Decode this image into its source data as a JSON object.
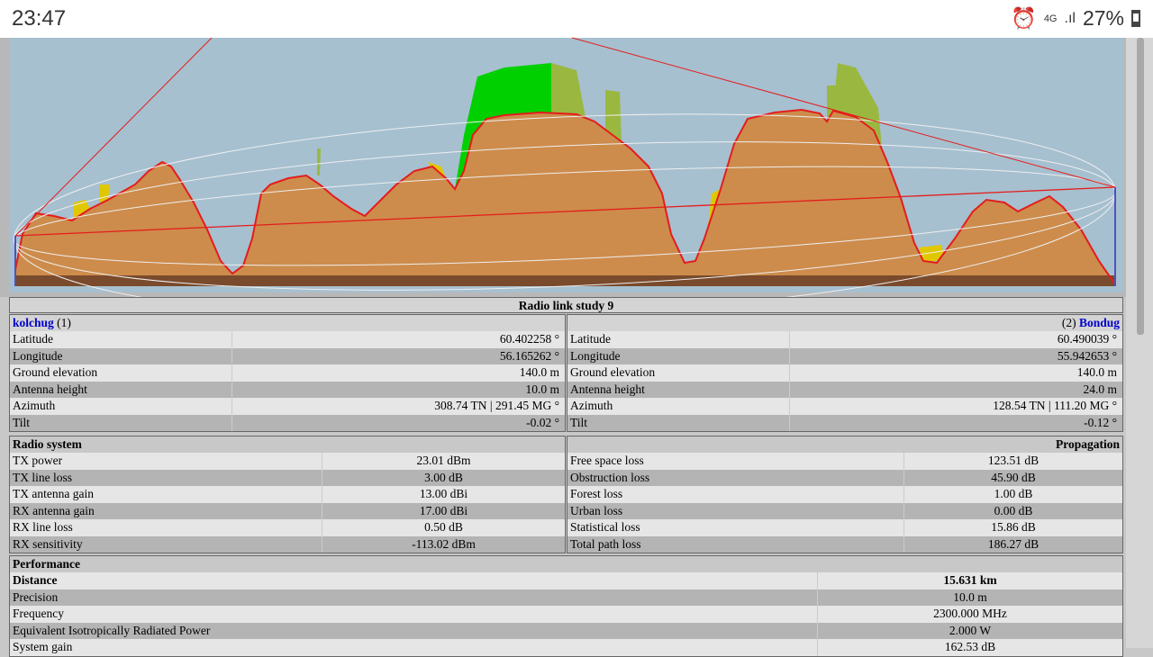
{
  "status_bar": {
    "time": "23:47",
    "network": "4G",
    "battery": "27%",
    "icons": [
      "alarm-icon",
      "signal-icon",
      "battery-icon"
    ]
  },
  "title": "Radio link study 9",
  "site1": {
    "name": "kolchug",
    "index": "(1)",
    "rows": [
      {
        "label": "Latitude",
        "value": "60.402258 °"
      },
      {
        "label": "Longitude",
        "value": "56.165262 °"
      },
      {
        "label": "Ground elevation",
        "value": "140.0 m"
      },
      {
        "label": "Antenna height",
        "value": "10.0 m"
      },
      {
        "label": "Azimuth",
        "value": "308.74 TN | 291.45 MG °"
      },
      {
        "label": "Tilt",
        "value": "-0.02 °"
      }
    ]
  },
  "site2": {
    "name": "Bondug",
    "index": "(2)",
    "rows": [
      {
        "label": "Latitude",
        "value": "60.490039 °"
      },
      {
        "label": "Longitude",
        "value": "55.942653 °"
      },
      {
        "label": "Ground elevation",
        "value": "140.0 m"
      },
      {
        "label": "Antenna height",
        "value": "24.0 m"
      },
      {
        "label": "Azimuth",
        "value": "128.54 TN | 111.20 MG °"
      },
      {
        "label": "Tilt",
        "value": "-0.12 °"
      }
    ]
  },
  "radio": {
    "heading": "Radio system",
    "rows": [
      {
        "label": "TX power",
        "value": "23.01 dBm"
      },
      {
        "label": "TX line loss",
        "value": "3.00 dB"
      },
      {
        "label": "TX antenna gain",
        "value": "13.00 dBi"
      },
      {
        "label": "RX antenna gain",
        "value": "17.00 dBi"
      },
      {
        "label": "RX line loss",
        "value": "0.50 dB"
      },
      {
        "label": "RX sensitivity",
        "value": "-113.02 dBm"
      }
    ]
  },
  "propagation": {
    "heading": "Propagation",
    "rows": [
      {
        "label": "Free space loss",
        "value": "123.51 dB"
      },
      {
        "label": "Obstruction loss",
        "value": "45.90 dB"
      },
      {
        "label": "Forest loss",
        "value": "1.00 dB"
      },
      {
        "label": "Urban loss",
        "value": "0.00 dB"
      },
      {
        "label": "Statistical loss",
        "value": "15.86 dB"
      },
      {
        "label": "Total path loss",
        "value": "186.27 dB"
      }
    ]
  },
  "performance": {
    "heading": "Performance",
    "rows": [
      {
        "label": "Distance",
        "value": "15.631 km"
      },
      {
        "label": "Precision",
        "value": "10.0 m"
      },
      {
        "label": "Frequency",
        "value": "2300.000 MHz"
      },
      {
        "label": "Equivalent Isotropically Radiated Power",
        "value": "2.000 W"
      },
      {
        "label": "System gain",
        "value": "162.53 dB"
      }
    ]
  }
}
